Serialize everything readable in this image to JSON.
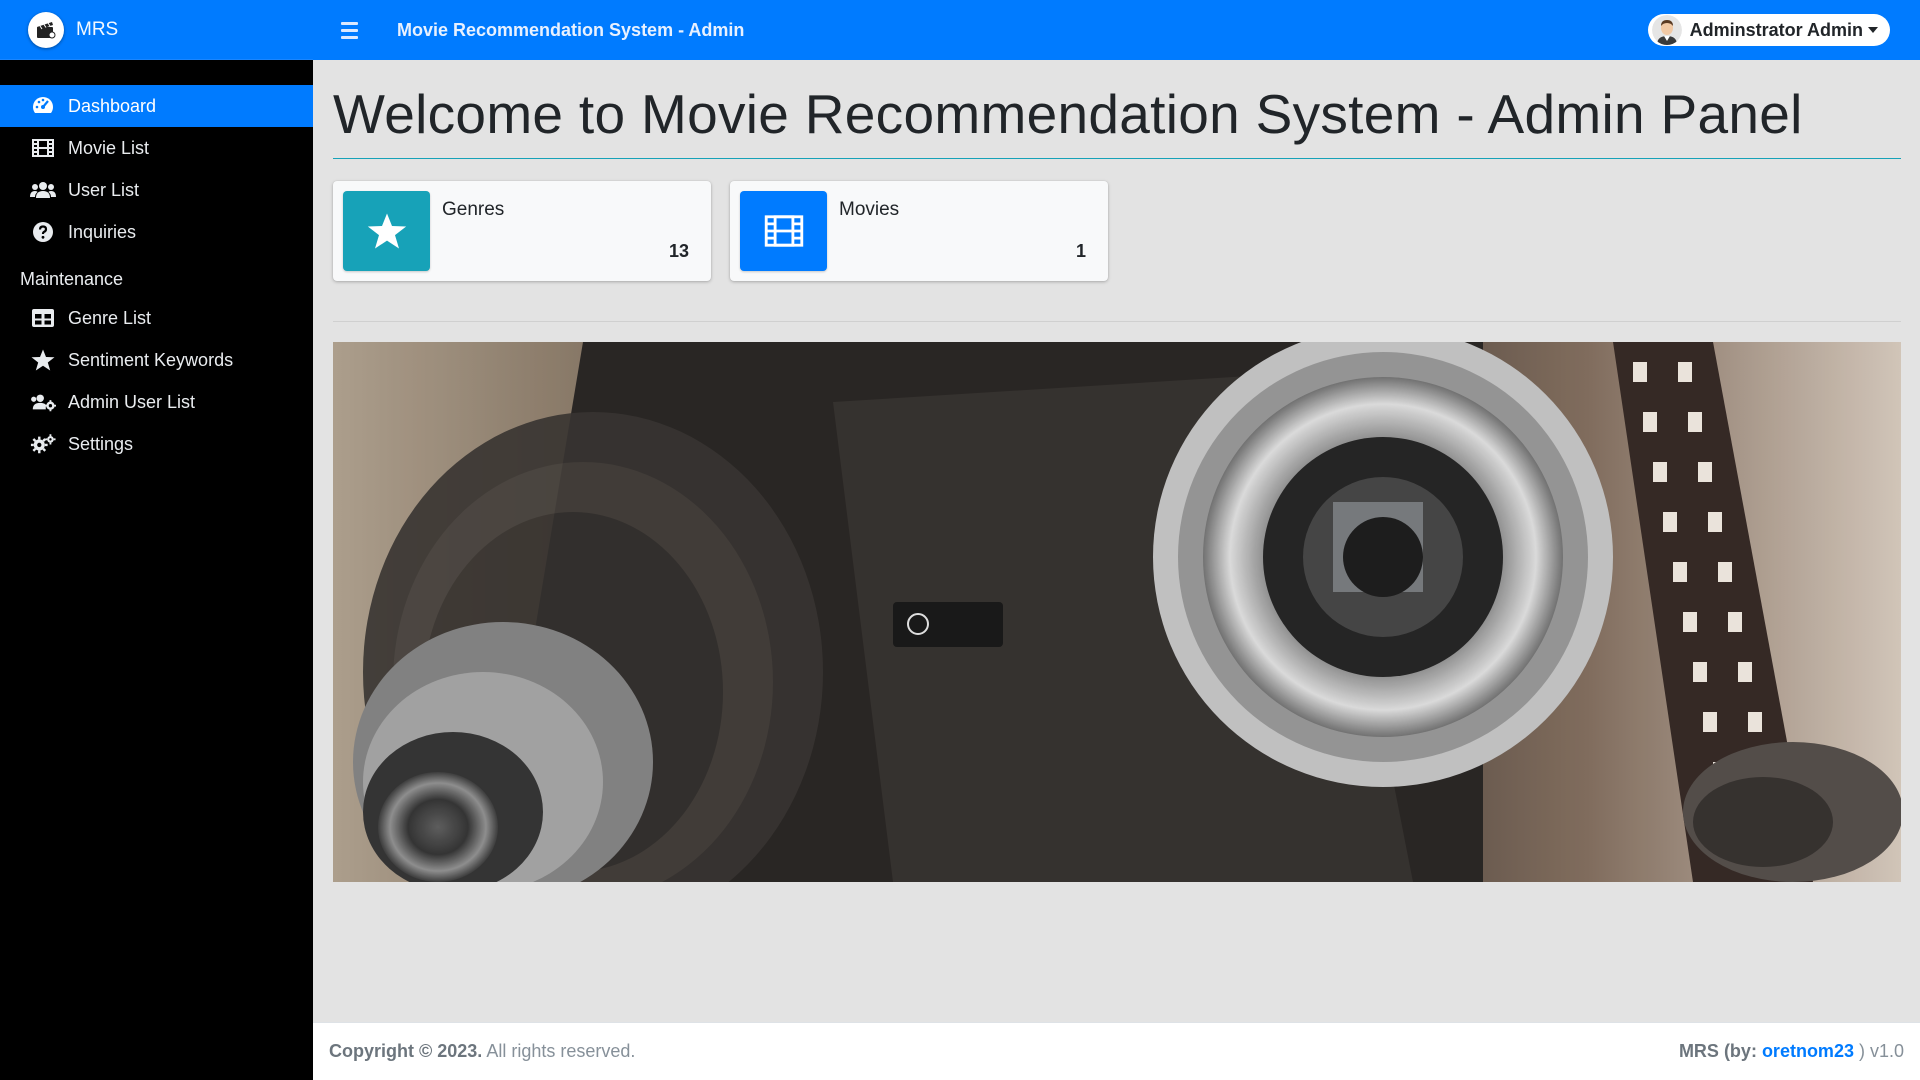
{
  "brand": {
    "name": "MRS"
  },
  "topbar": {
    "title": "Movie Recommendation System - Admin",
    "user_name": "Adminstrator Admin"
  },
  "sidebar": {
    "items": [
      {
        "label": "Dashboard",
        "icon": "tachometer-icon",
        "active": true
      },
      {
        "label": "Movie List",
        "icon": "film-icon"
      },
      {
        "label": "User List",
        "icon": "users-icon"
      },
      {
        "label": "Inquiries",
        "icon": "question-circle-icon"
      }
    ],
    "section_header": "Maintenance",
    "maintenance_items": [
      {
        "label": "Genre List",
        "icon": "table-icon"
      },
      {
        "label": "Sentiment Keywords",
        "icon": "star-icon"
      },
      {
        "label": "Admin User List",
        "icon": "users-cog-icon"
      },
      {
        "label": "Settings",
        "icon": "cogs-icon"
      }
    ]
  },
  "main": {
    "title": "Welcome to Movie Recommendation System - Admin Panel",
    "cards": [
      {
        "label": "Genres",
        "value": "13",
        "icon": "star-icon",
        "color": "#17a2b8"
      },
      {
        "label": "Movies",
        "value": "1",
        "icon": "film-icon",
        "color": "#007bff"
      }
    ],
    "banner": {
      "description_icon": "vintage-camera-image"
    }
  },
  "footer": {
    "copyright_bold": "Copyright © 2023.",
    "copyright_rest": " All rights reserved.",
    "right_prefix": "MRS (by: ",
    "right_link": "oretnom23",
    "right_suffix": " ) v1.0"
  },
  "colors": {
    "primary": "#007bff",
    "info": "#17a2b8",
    "sidebar": "#000000"
  }
}
